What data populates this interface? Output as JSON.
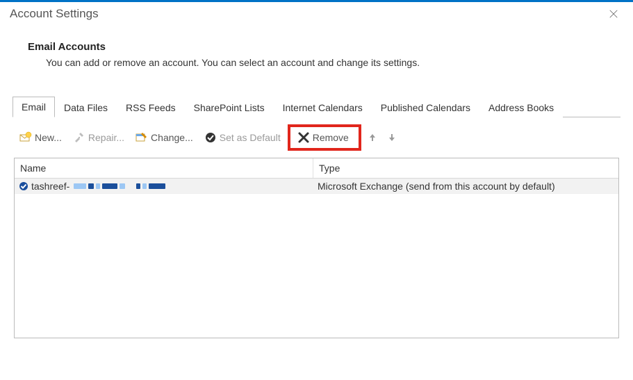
{
  "window": {
    "title": "Account Settings"
  },
  "intro": {
    "heading": "Email Accounts",
    "body": "You can add or remove an account. You can select an account and change its settings."
  },
  "tabs": [
    {
      "label": "Email",
      "active": true
    },
    {
      "label": "Data Files",
      "active": false
    },
    {
      "label": "RSS Feeds",
      "active": false
    },
    {
      "label": "SharePoint Lists",
      "active": false
    },
    {
      "label": "Internet Calendars",
      "active": false
    },
    {
      "label": "Published Calendars",
      "active": false
    },
    {
      "label": "Address Books",
      "active": false
    }
  ],
  "toolbar": {
    "new_label": "New...",
    "repair_label": "Repair...",
    "change_label": "Change...",
    "set_default_label": "Set as Default",
    "remove_label": "Remove"
  },
  "columns": {
    "name": "Name",
    "type": "Type"
  },
  "accounts": [
    {
      "name_prefix": "tashreef-",
      "type": "Microsoft Exchange (send from this account by default)",
      "is_default": true
    }
  ]
}
